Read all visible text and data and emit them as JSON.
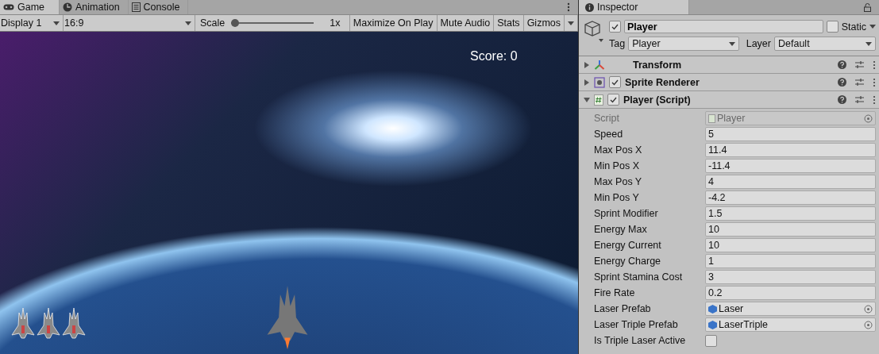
{
  "game_panel": {
    "tabs": [
      {
        "label": "Game",
        "selected": true
      },
      {
        "label": "Animation",
        "selected": false
      },
      {
        "label": "Console",
        "selected": false
      }
    ],
    "toolbar": {
      "display": "Display 1",
      "aspect": "16:9",
      "scale_label": "Scale",
      "scale": {
        "level": 0
      },
      "scale_reading": "1x",
      "buttons": [
        "Maximize On Play",
        "Mute Audio",
        "Stats",
        "Gizmos"
      ]
    },
    "scene": {
      "score": "Score: 0"
    }
  },
  "inspector": {
    "tab": {
      "label": "Inspector",
      "selected": true
    },
    "object": {
      "active": true,
      "name": "Player",
      "static_label": "Static",
      "static": false,
      "tag_label": "Tag",
      "tag": "Player",
      "layer_label": "Layer",
      "layer": "Default"
    },
    "components": [
      {
        "name": "Transform",
        "expanded": false
      },
      {
        "name": "Sprite Renderer",
        "expanded": false,
        "enabled": true
      },
      {
        "name": "Player (Script)",
        "expanded": true,
        "enabled": true
      }
    ],
    "fields": [
      {
        "kind": "script",
        "label": "Script",
        "value": "Player"
      },
      {
        "kind": "number",
        "label": "Speed",
        "value": "5"
      },
      {
        "kind": "number",
        "label": "Max Pos X",
        "value": "11.4"
      },
      {
        "kind": "number",
        "label": "Min Pos X",
        "value": "-11.4"
      },
      {
        "kind": "number",
        "label": "Max Pos Y",
        "value": "4"
      },
      {
        "kind": "number",
        "label": "Min Pos Y",
        "value": "-4.2"
      },
      {
        "kind": "number",
        "label": "Sprint Modifier",
        "value": "1.5"
      },
      {
        "kind": "number",
        "label": "Energy Max",
        "value": "10"
      },
      {
        "kind": "number",
        "label": "Energy Current",
        "value": "10"
      },
      {
        "kind": "number",
        "label": "Energy Charge",
        "value": "1"
      },
      {
        "kind": "number",
        "label": "Sprint Stamina Cost",
        "value": "3"
      },
      {
        "kind": "number",
        "label": "Fire Rate",
        "value": "0.2"
      },
      {
        "kind": "object",
        "label": "Laser Prefab",
        "value": "Laser"
      },
      {
        "kind": "object",
        "label": "Laser Triple Prefab",
        "value": "LaserTriple"
      },
      {
        "kind": "checkbox",
        "label": "Is Triple Laser Active",
        "checked": false
      }
    ]
  }
}
